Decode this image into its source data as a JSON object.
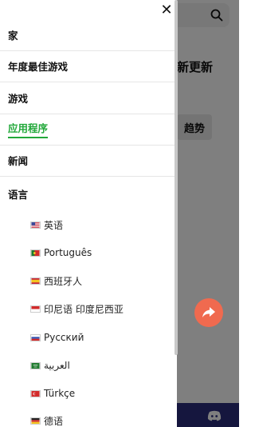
{
  "background": {
    "heading": "新更新",
    "trend_button": "趋势"
  },
  "drawer": {
    "close_symbol": "✕",
    "nav": [
      {
        "label": "家",
        "active": false
      },
      {
        "label": "年度最佳游戏",
        "active": false
      },
      {
        "label": "游戏",
        "active": false
      },
      {
        "label": "应用程序",
        "active": true
      },
      {
        "label": "新闻",
        "active": false
      }
    ],
    "language_header": "语言",
    "languages": [
      {
        "label": "英语",
        "flag": "us-flag"
      },
      {
        "label": "Português",
        "flag": "portugal-flag"
      },
      {
        "label": "西班牙人",
        "flag": "spain-flag"
      },
      {
        "label": "印尼语 印度尼西亚",
        "flag": "indonesia-flag"
      },
      {
        "label": "Русский",
        "flag": "russia-flag"
      },
      {
        "label": "العربية",
        "flag": "saudi-flag"
      },
      {
        "label": "Türkçe",
        "flag": "turkey-flag"
      },
      {
        "label": "德语",
        "flag": "germany-flag"
      }
    ]
  },
  "colors": {
    "accent_green": "#22a83a",
    "fab": "#f06a4f",
    "bottom_bar": "#2a2d7c"
  }
}
